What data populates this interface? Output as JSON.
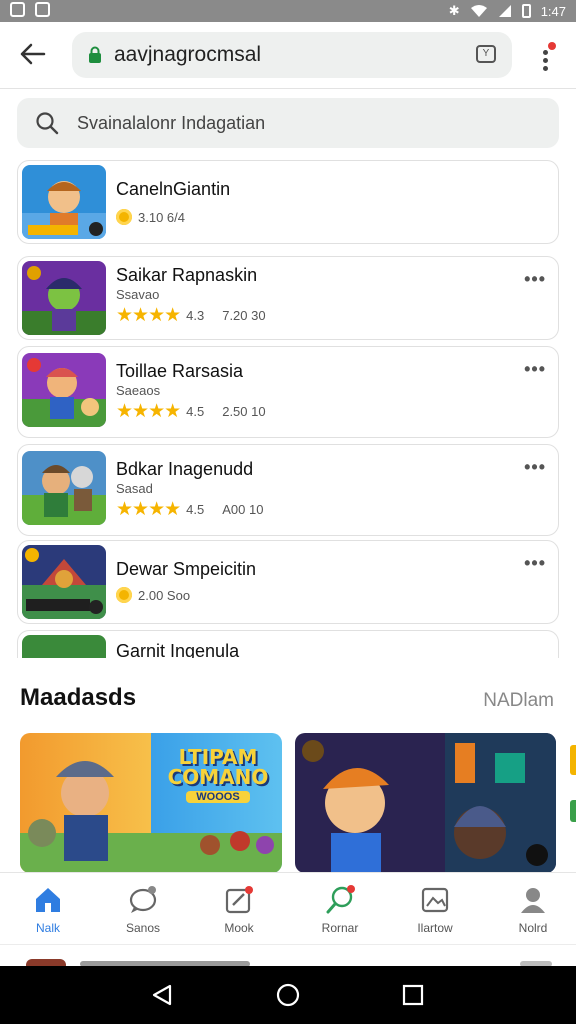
{
  "status_bar": {
    "time": "1:47"
  },
  "browser": {
    "url": "aavjnagrocmsal"
  },
  "search": {
    "placeholder": "Svainalalonr Indagatian"
  },
  "apps": [
    {
      "title": "CanelnGiantin",
      "subtitle": "",
      "rating": "",
      "count": "3.10 6/4",
      "meta_icon": "coin-icon",
      "has_more": false
    },
    {
      "title": "Saikar Rapnaskin",
      "subtitle": "Ssavao",
      "rating": "4.3",
      "count": "7.20 30",
      "meta_icon": "star-icon",
      "has_more": true
    },
    {
      "title": "Toillae Rarsasia",
      "subtitle": "Saeaos",
      "rating": "4.5",
      "count": "2.50 10",
      "meta_icon": "star-icon",
      "has_more": true
    },
    {
      "title": "Bdkar Inagenudd",
      "subtitle": "Sasad",
      "rating": "4.5",
      "count": "A00 10",
      "meta_icon": "star-icon",
      "has_more": true
    },
    {
      "title": "Dewar Smpeicitin",
      "subtitle": "",
      "rating": "",
      "count": "2.00 Soo",
      "meta_icon": "coin-icon",
      "has_more": true
    }
  ],
  "partial_item": {
    "title": "Garnit Ingenula"
  },
  "section": {
    "title": "Maadasds",
    "link": "NADlam"
  },
  "featured": [
    {
      "banner_text": "LTIPAM COMANO",
      "badge_text": "WOOOS"
    },
    {
      "banner_text": ""
    }
  ],
  "nav": [
    {
      "label": "Nalk",
      "icon": "home-icon",
      "active": true
    },
    {
      "label": "Sanos",
      "icon": "chat-icon",
      "active": false
    },
    {
      "label": "Mook",
      "icon": "edit-icon",
      "active": false
    },
    {
      "label": "Rornar",
      "icon": "search-icon",
      "active": false
    },
    {
      "label": "Ilartow",
      "icon": "image-icon",
      "active": false
    },
    {
      "label": "Nolrd",
      "icon": "person-icon",
      "active": false
    }
  ],
  "colors": {
    "accent": "#2f7de1",
    "star": "#f6b400",
    "statusbar": "#8a8a8a",
    "notify": "#e53935"
  }
}
